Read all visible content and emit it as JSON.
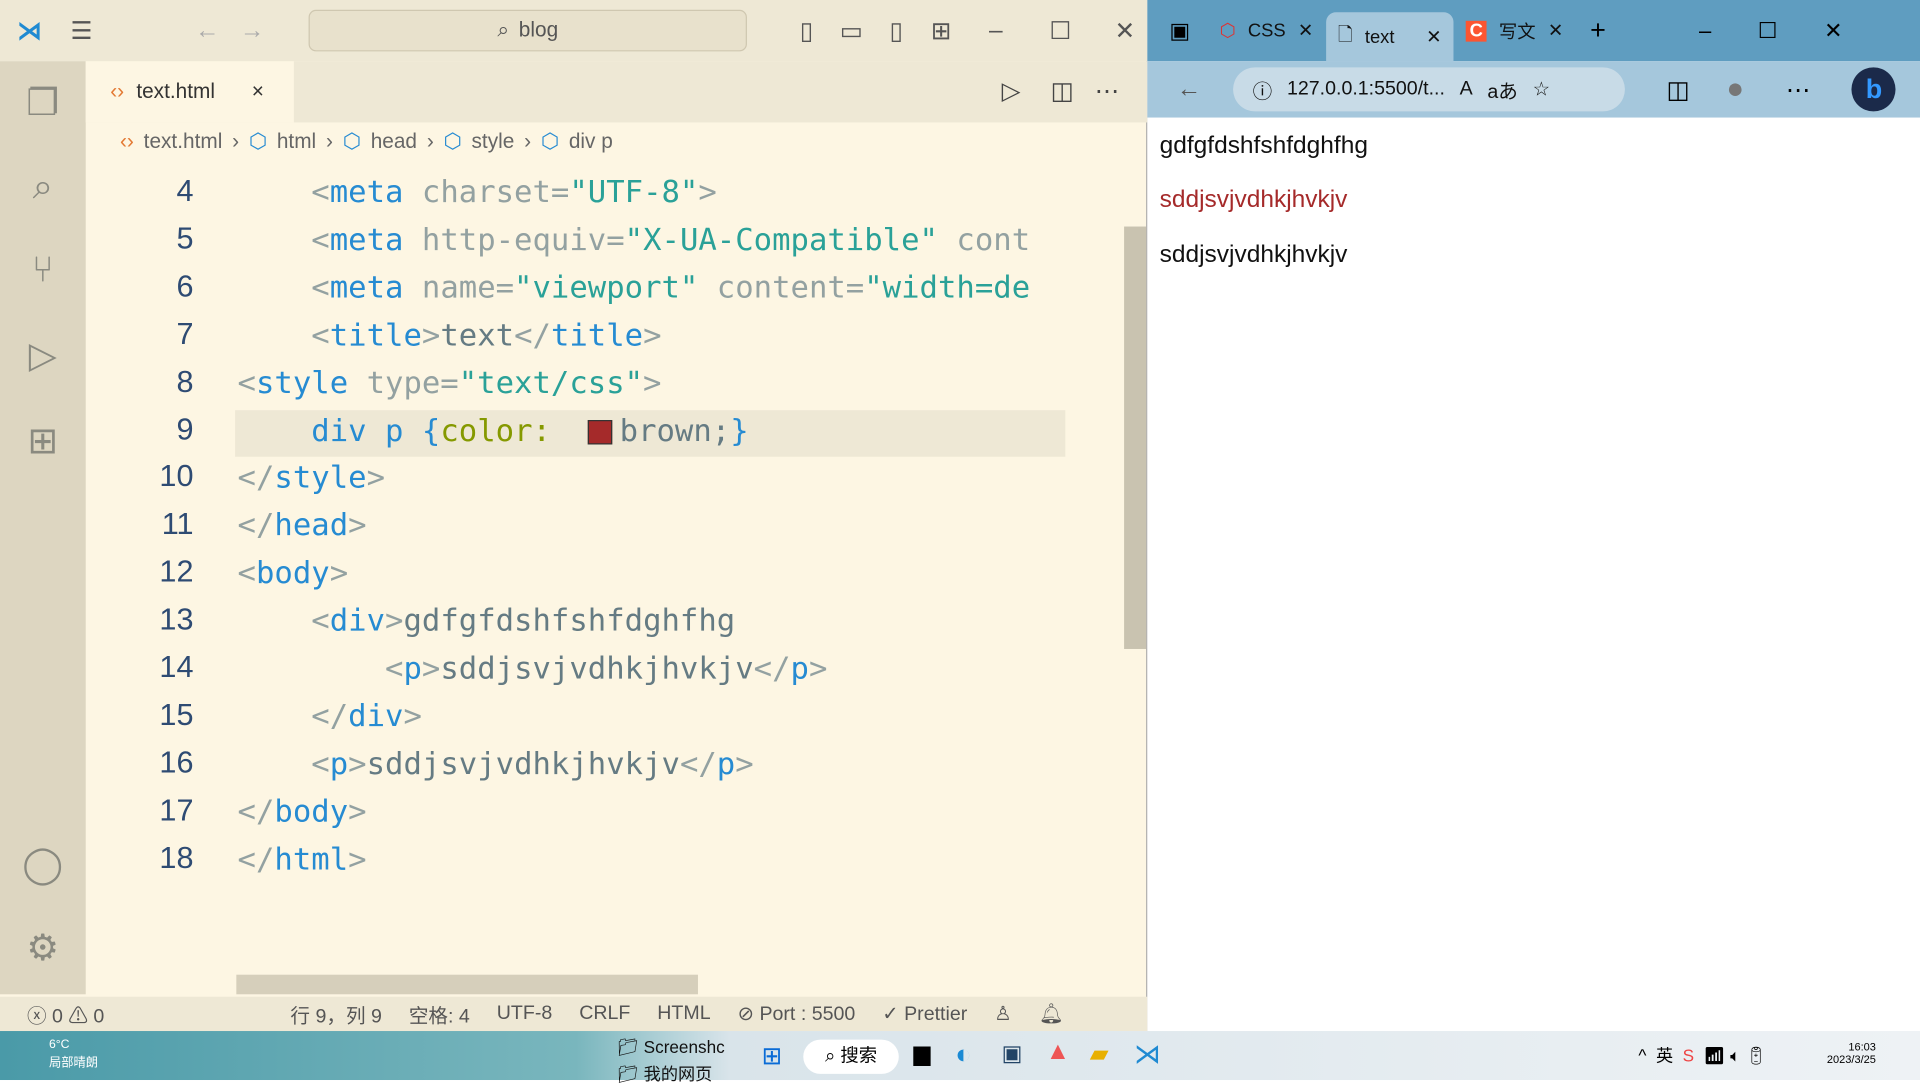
{
  "vscode": {
    "search": "blog",
    "tab": {
      "label": "text.html",
      "close": "×"
    },
    "breadcrumb": [
      "text.html",
      "html",
      "head",
      "style",
      "div p"
    ],
    "lines": [
      {
        "n": "4",
        "t": [
          [
            "    ",
            ""
          ],
          [
            "<",
            "b"
          ],
          [
            "meta",
            "t"
          ],
          [
            " charset=",
            "a"
          ],
          [
            "\"UTF-8\"",
            "s"
          ],
          [
            ">",
            "b"
          ]
        ]
      },
      {
        "n": "5",
        "t": [
          [
            "    ",
            ""
          ],
          [
            "<",
            "b"
          ],
          [
            "meta",
            "t"
          ],
          [
            " http-equiv=",
            "a"
          ],
          [
            "\"X-UA-Compatible\"",
            "s"
          ],
          [
            " cont",
            "a"
          ]
        ]
      },
      {
        "n": "6",
        "t": [
          [
            "    ",
            ""
          ],
          [
            "<",
            "b"
          ],
          [
            "meta",
            "t"
          ],
          [
            " name=",
            "a"
          ],
          [
            "\"viewport\"",
            "s"
          ],
          [
            " content=",
            "a"
          ],
          [
            "\"width=de",
            "s"
          ]
        ]
      },
      {
        "n": "7",
        "t": [
          [
            "    ",
            ""
          ],
          [
            "<",
            "b"
          ],
          [
            "title",
            "t"
          ],
          [
            ">",
            "b"
          ],
          [
            "text",
            "x"
          ],
          [
            "</",
            "b"
          ],
          [
            "title",
            "t"
          ],
          [
            ">",
            "b"
          ]
        ]
      },
      {
        "n": "8",
        "t": [
          [
            "<",
            "b"
          ],
          [
            "style",
            "t"
          ],
          [
            " type=",
            "a"
          ],
          [
            "\"text/css\"",
            "s"
          ],
          [
            ">",
            "b"
          ]
        ]
      },
      {
        "n": "9",
        "t": [
          [
            "    ",
            ""
          ],
          [
            "div",
            "t"
          ],
          [
            " ",
            ""
          ],
          [
            "p",
            "t"
          ],
          [
            " {",
            "t"
          ],
          [
            "color:",
            "k"
          ],
          [
            "  ",
            ""
          ],
          [
            "SWATCH",
            ""
          ],
          [
            "brown;",
            "x"
          ],
          [
            "}",
            "t"
          ]
        ]
      },
      {
        "n": "10",
        "t": [
          [
            "</",
            "b"
          ],
          [
            "style",
            "t"
          ],
          [
            ">",
            "b"
          ]
        ]
      },
      {
        "n": "11",
        "t": [
          [
            "</",
            "b"
          ],
          [
            "head",
            "t"
          ],
          [
            ">",
            "b"
          ]
        ]
      },
      {
        "n": "12",
        "t": [
          [
            "<",
            "b"
          ],
          [
            "body",
            "t"
          ],
          [
            ">",
            "b"
          ]
        ]
      },
      {
        "n": "13",
        "t": [
          [
            "    ",
            ""
          ],
          [
            "<",
            "b"
          ],
          [
            "div",
            "t"
          ],
          [
            ">",
            "b"
          ],
          [
            "gdfgfdshfshfdghfhg",
            "x"
          ]
        ]
      },
      {
        "n": "14",
        "t": [
          [
            "        ",
            ""
          ],
          [
            "<",
            "b"
          ],
          [
            "p",
            "t"
          ],
          [
            ">",
            "b"
          ],
          [
            "sddjsvjvdhkjhvkjv",
            "x"
          ],
          [
            "</",
            "b"
          ],
          [
            "p",
            "t"
          ],
          [
            ">",
            "b"
          ]
        ]
      },
      {
        "n": "15",
        "t": [
          [
            "    ",
            ""
          ],
          [
            "</",
            "b"
          ],
          [
            "div",
            "t"
          ],
          [
            ">",
            "b"
          ]
        ]
      },
      {
        "n": "16",
        "t": [
          [
            "    ",
            ""
          ],
          [
            "<",
            "b"
          ],
          [
            "p",
            "t"
          ],
          [
            ">",
            "b"
          ],
          [
            "sddjsvjvdhkjhvkjv",
            "x"
          ],
          [
            "</",
            "b"
          ],
          [
            "p",
            "t"
          ],
          [
            ">",
            "b"
          ]
        ]
      },
      {
        "n": "17",
        "t": [
          [
            "</",
            "b"
          ],
          [
            "body",
            "t"
          ],
          [
            ">",
            "b"
          ]
        ]
      },
      {
        "n": "18",
        "t": [
          [
            "</",
            "b"
          ],
          [
            "html",
            "t"
          ],
          [
            ">",
            "b"
          ]
        ]
      }
    ],
    "swatch_color": "#a52a2a",
    "status": {
      "errors": "0",
      "warnings": "0",
      "position": "行 9，列 9",
      "spaces": "空格: 4",
      "encoding": "UTF-8",
      "eol": "CRLF",
      "language": "HTML",
      "port": "Port : 5500",
      "prettier": "Prettier"
    }
  },
  "browser": {
    "tabs": [
      {
        "label": "CSS"
      },
      {
        "label": "text"
      },
      {
        "label": "写文"
      }
    ],
    "url": "127.0.0.1:5500/t...",
    "content": [
      {
        "text": "gdfgfdshfshfdghfhg",
        "color": "#000000"
      },
      {
        "text": "sddjsvjvdhkjhvkjv",
        "color": "#a52a2a"
      },
      {
        "text": "sddjsvjvdhkjhvkjv",
        "color": "#000000"
      }
    ]
  },
  "taskbar": {
    "weather_temp": "6°C",
    "weather_desc": "局部晴朗",
    "folder1": "Screenshc",
    "folder2": "我的网页",
    "search": "搜索",
    "time": "16:03",
    "date": "2023/3/25"
  }
}
